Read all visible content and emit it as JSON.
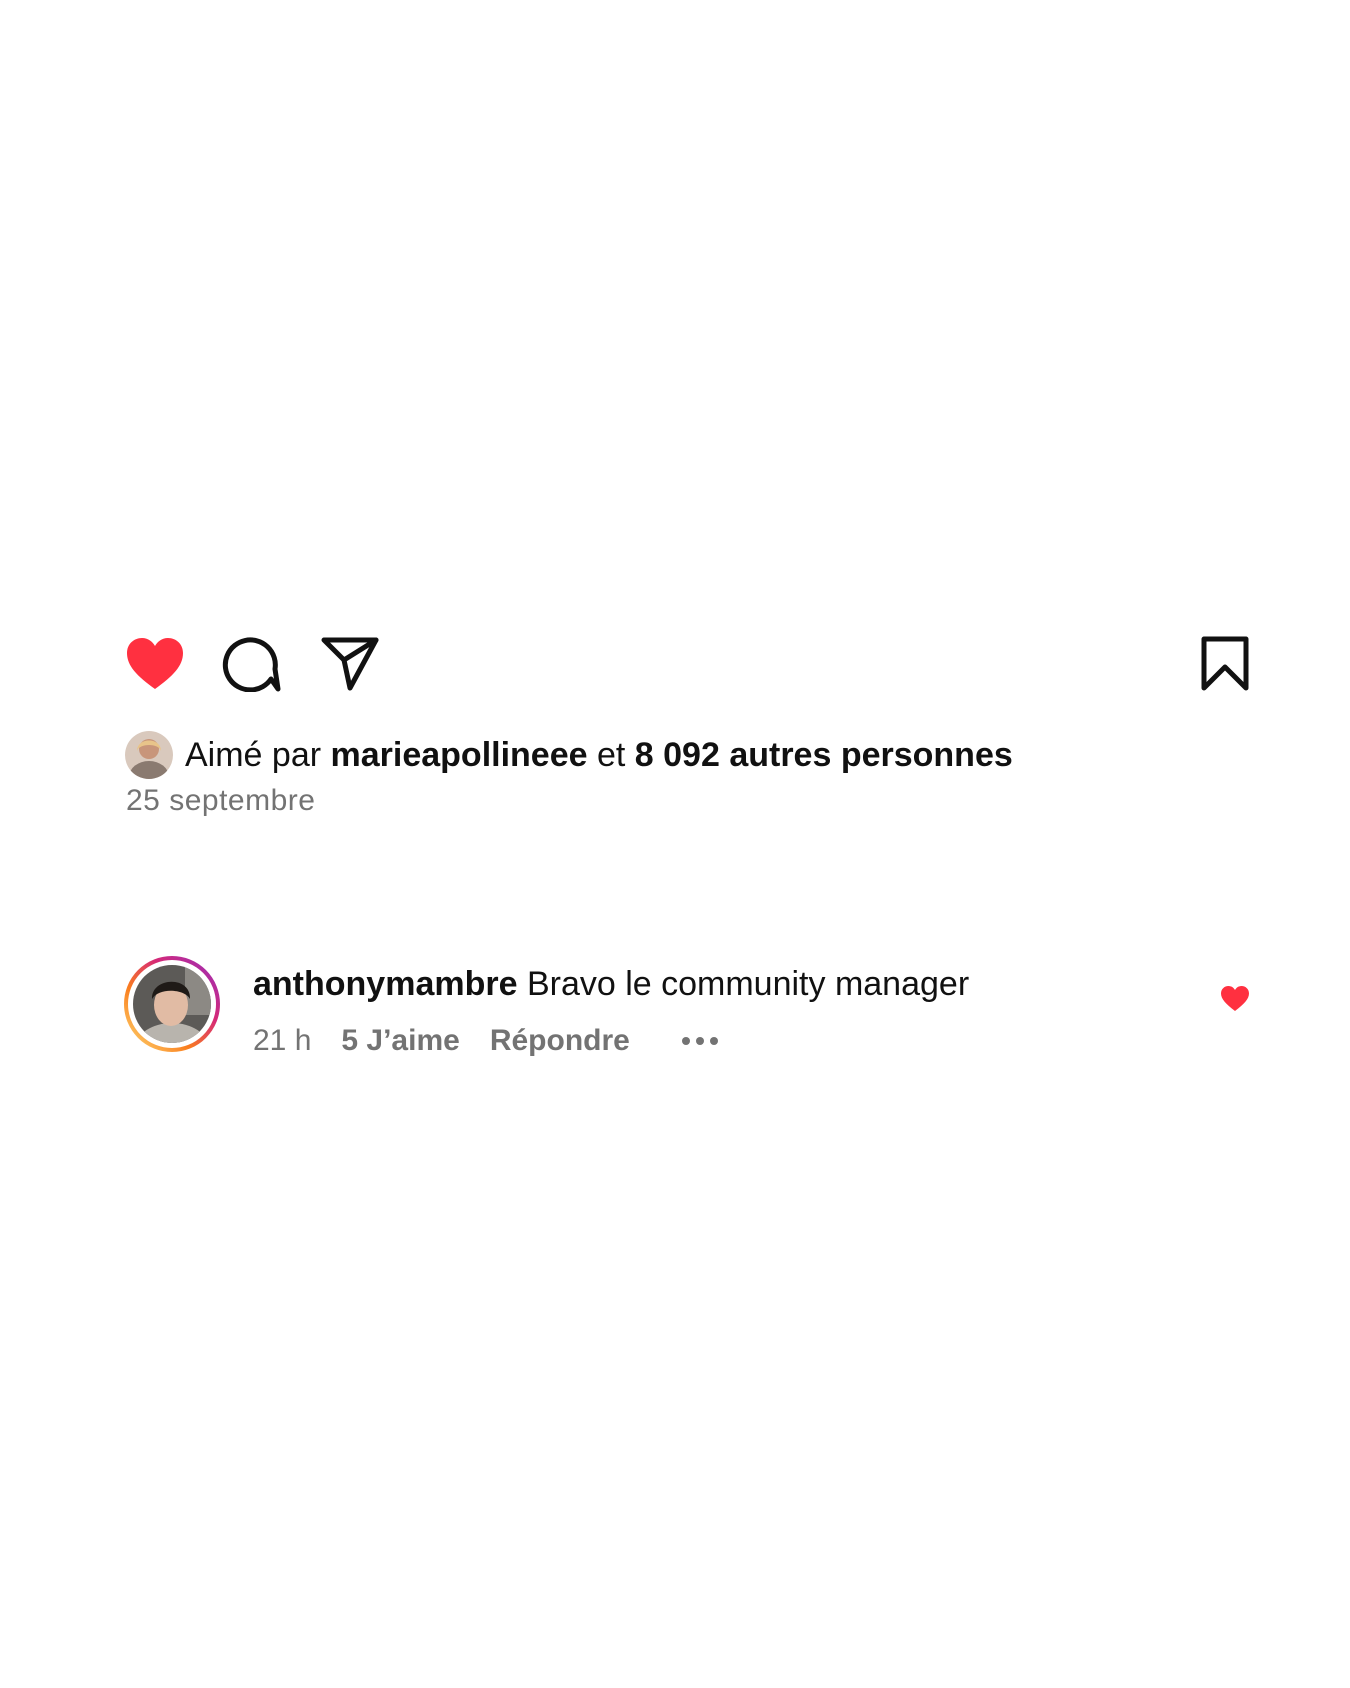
{
  "actions": {
    "like_icon": "heart-filled-icon",
    "comment_icon": "comment-bubble-icon",
    "share_icon": "paper-plane-icon",
    "save_icon": "bookmark-icon",
    "liked_color": "#ff3040"
  },
  "likes": {
    "prefix": "Aimé par",
    "user": "marieapollineee",
    "connector": "et",
    "others": "8 092 autres personnes"
  },
  "post": {
    "date": "25 septembre"
  },
  "comment": {
    "username": "anthonymambre",
    "text": "Bravo le community manager",
    "time": "21 h",
    "likes": "5 J’aime",
    "reply": "Répondre",
    "more_icon": "more-dots-icon",
    "like_icon": "heart-small-icon"
  }
}
